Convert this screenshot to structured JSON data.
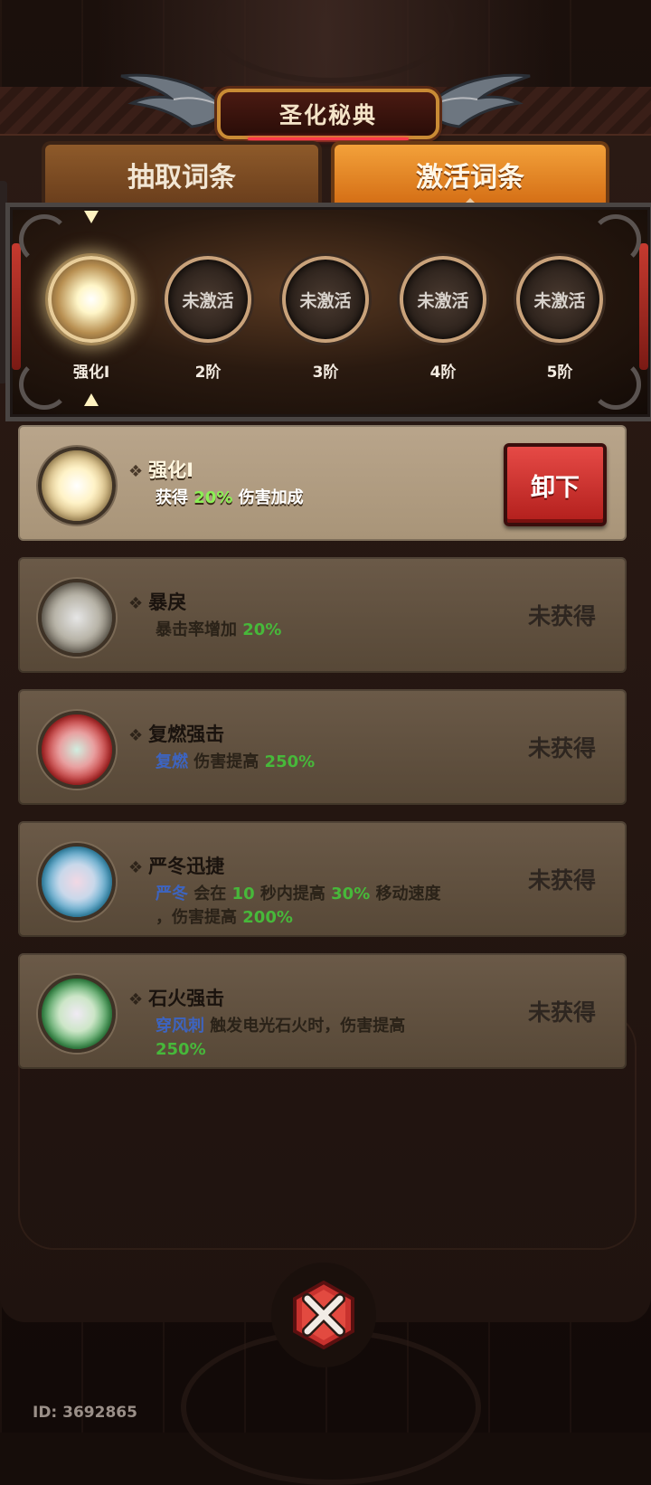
{
  "header": {
    "title": "圣化秘典"
  },
  "tabs": {
    "draw": "抽取词条",
    "activate": "激活词条"
  },
  "tiers": [
    {
      "ring_text": "",
      "label": "强化I",
      "active": true
    },
    {
      "ring_text": "未激活",
      "label": "2阶"
    },
    {
      "ring_text": "未激活",
      "label": "3阶"
    },
    {
      "ring_text": "未激活",
      "label": "4阶"
    },
    {
      "ring_text": "未激活",
      "label": "5阶"
    }
  ],
  "cards": [
    {
      "name": "强化I",
      "desc": {
        "pre": "获得 ",
        "v1": "20%",
        "post": " 伤害加成"
      },
      "action": "卸下",
      "orb_color": "white"
    },
    {
      "name": "暴戾",
      "desc": {
        "pre": "暴击率增加 ",
        "v1": "20%"
      },
      "status": "未获得",
      "orb_color": "gray"
    },
    {
      "name": "复燃强击",
      "desc": {
        "k": "复燃",
        "mid": " 伤害提高 ",
        "v1": "250%"
      },
      "status": "未获得",
      "orb_color": "red"
    },
    {
      "name": "严冬迅捷",
      "desc": {
        "k": "严冬",
        "a": " 会在 ",
        "v1": "10",
        "b": " 秒内提高 ",
        "v2": "30%",
        "c": " 移动速度",
        "d": "，伤害提高 ",
        "v3": "200%"
      },
      "status": "未获得",
      "orb_color": "blue"
    },
    {
      "name": "石火强击",
      "desc": {
        "k": "穿风刺",
        "a": " 触发电光石火时，伤害提高",
        "v1": "250%"
      },
      "status": "未获得",
      "orb_color": "green"
    }
  ],
  "footer": {
    "id_text": "ID: 3692865"
  },
  "colors": {
    "accent_orange": "#e38423",
    "unload_red": "#d23330",
    "value_green": "#47b83a",
    "keyword_blue": "#3d64c0"
  }
}
